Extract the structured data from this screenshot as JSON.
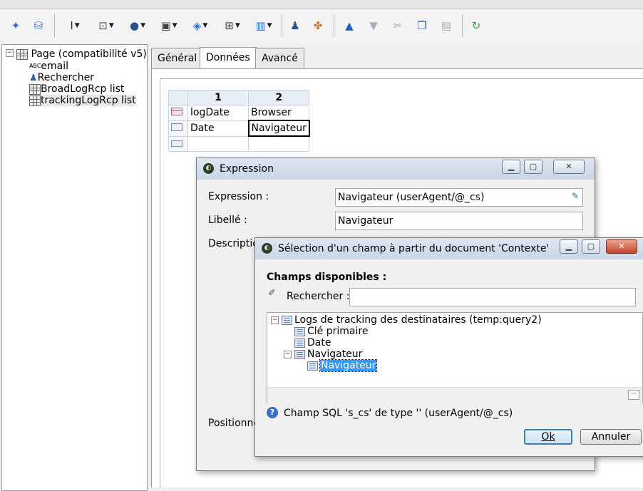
{
  "left_tree": {
    "root_label": "Page (compatibilité v5)",
    "items": [
      {
        "label": "email",
        "icon": "abc-text-icon",
        "icon_text": "ABC"
      },
      {
        "label": "Rechercher",
        "icon": "search-users-icon"
      },
      {
        "label": "BroadLogRcp list",
        "icon": "grid-icon"
      },
      {
        "label": "trackingLogRcp list",
        "icon": "grid-icon"
      }
    ]
  },
  "tabs": [
    {
      "label": "Général"
    },
    {
      "label": "Données"
    },
    {
      "label": "Avancé"
    }
  ],
  "grid": {
    "headers": [
      "1",
      "2"
    ],
    "rows": [
      {
        "c1": "logDate",
        "c2": "Browser"
      },
      {
        "c1": "Date",
        "c2": "Navigateur"
      },
      {
        "c1": "",
        "c2": ""
      }
    ]
  },
  "expression_dialog": {
    "title": "Expression",
    "expression_label": "Expression :",
    "expression_value": "Navigateur (userAgent/@_cs)",
    "libelle_label": "Libellé :",
    "libelle_value": "Navigateur",
    "description_label": "Descriptio",
    "position_label": "Positionne"
  },
  "select_dialog": {
    "title": "Sélection d'un champ à partir du document 'Contexte'",
    "section_title": "Champs disponibles :",
    "search_label": "Rechercher :",
    "search_value": "",
    "tree": {
      "root": "Logs de tracking des destinataires (temp:query2)",
      "children": [
        "Clé primaire",
        "Date",
        "Navigateur"
      ],
      "sub_child": "Navigateur"
    },
    "info_text": "Champ SQL 's_cs' de type '' (userAgent/@_cs)",
    "ok_label": "Ok",
    "cancel_label": "Annuler"
  },
  "colors": {
    "selection": "#3399ff",
    "title_bar": "#c9d6e6",
    "close_button": "#c6452c"
  }
}
